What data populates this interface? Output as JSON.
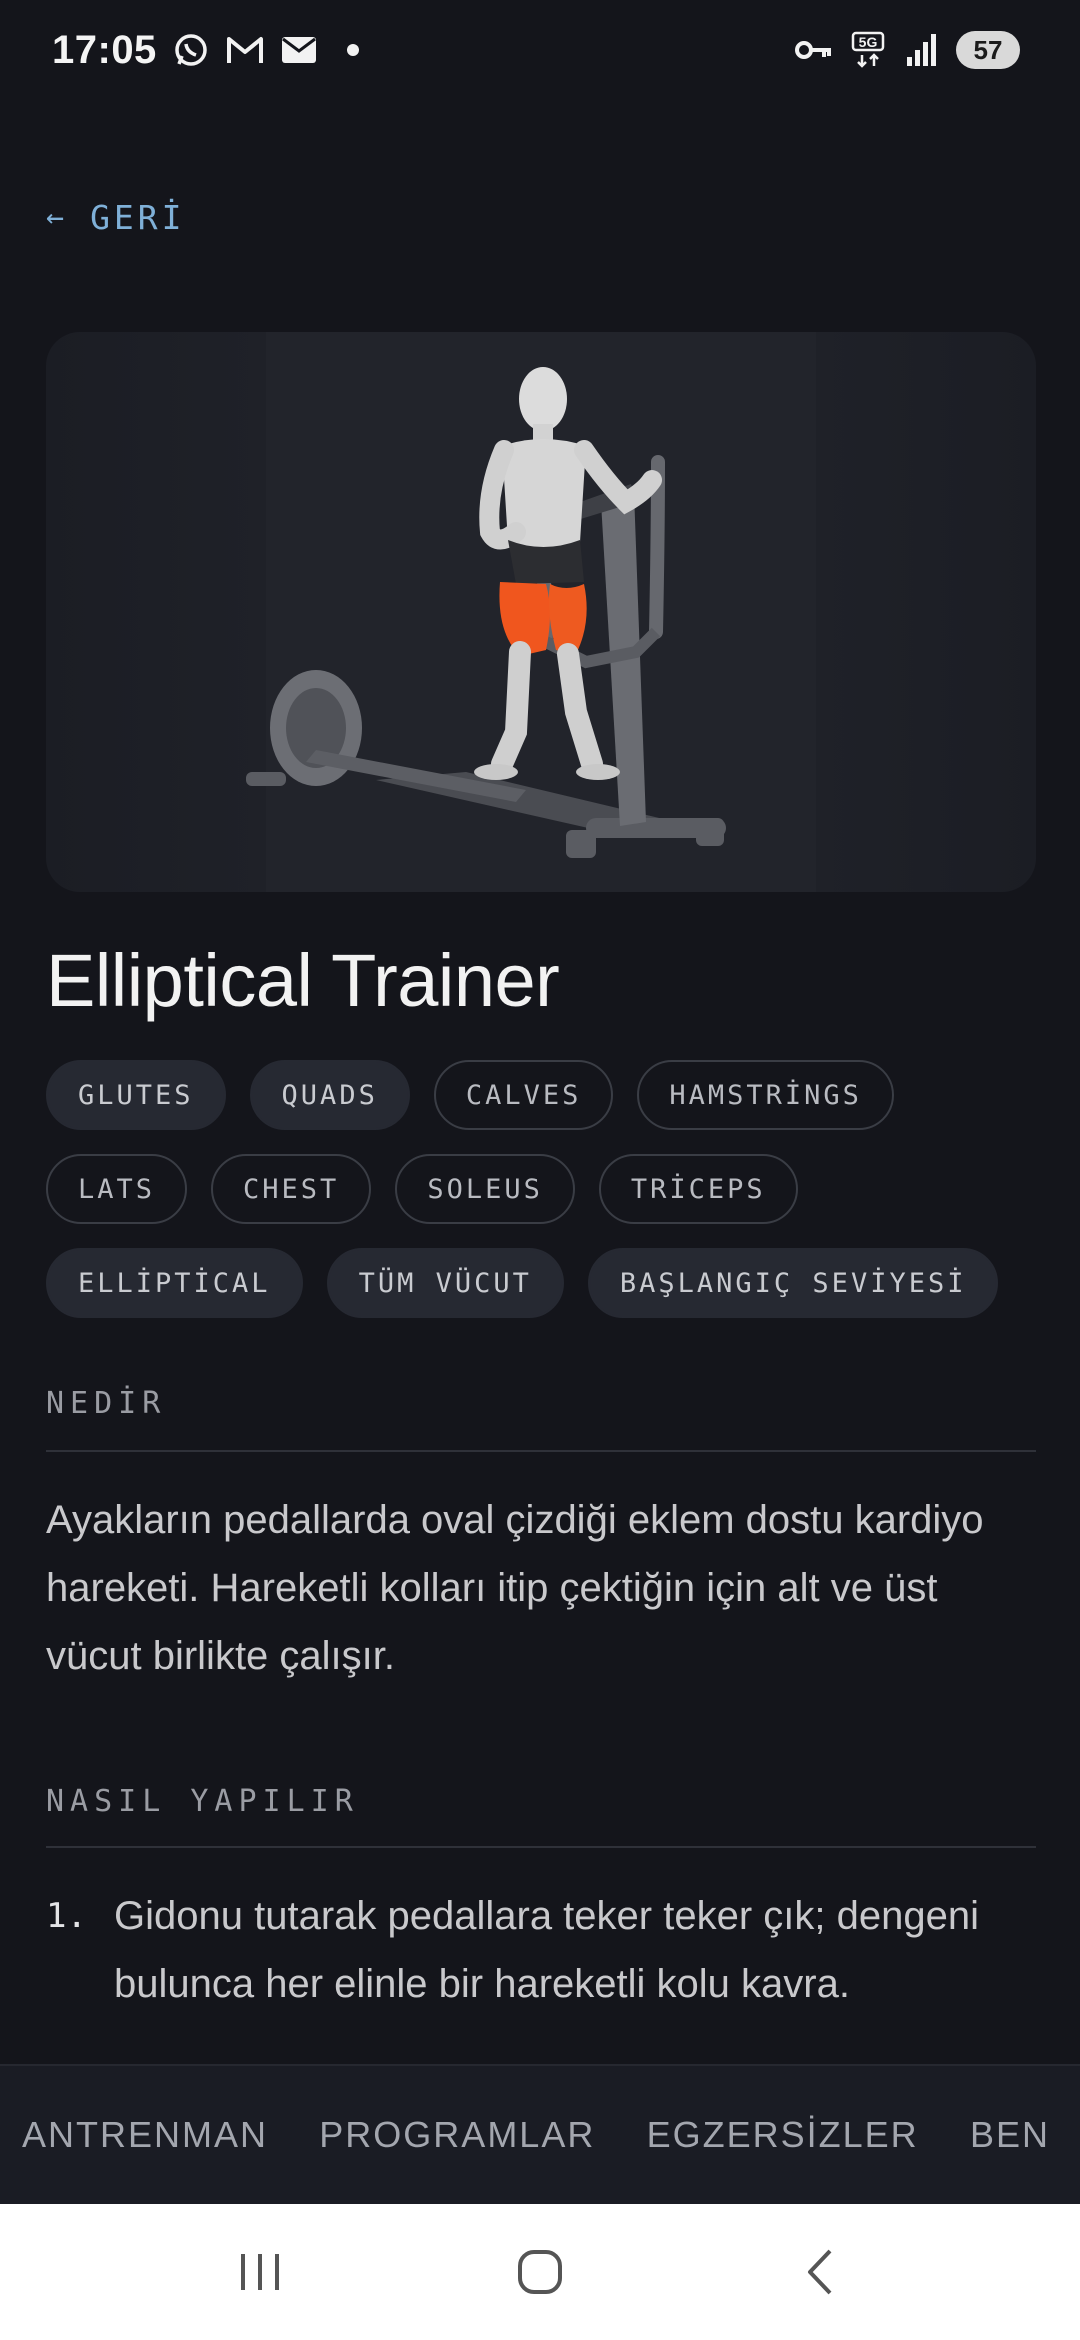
{
  "status_bar": {
    "time": "17:05",
    "network": "5G",
    "battery": "57",
    "icons": [
      "whatsapp-icon",
      "gmail-icon",
      "mail-icon",
      "dot-icon",
      "key-icon",
      "5g-icon",
      "signal-icon",
      "battery-icon"
    ]
  },
  "back": {
    "arrow": "←",
    "label": "GERİ"
  },
  "exercise": {
    "title": "Elliptical Trainer",
    "tags": [
      {
        "label": "GLUTES",
        "style": "filled"
      },
      {
        "label": "QUADS",
        "style": "filled"
      },
      {
        "label": "CALVES",
        "style": "outline"
      },
      {
        "label": "HAMSTRİNGS",
        "style": "outline"
      },
      {
        "label": "LATS",
        "style": "outline"
      },
      {
        "label": "CHEST",
        "style": "outline"
      },
      {
        "label": "SOLEUS",
        "style": "outline"
      },
      {
        "label": "TRİCEPS",
        "style": "outline"
      },
      {
        "label": "ELLİPTİCAL",
        "style": "filled"
      },
      {
        "label": "TÜM VÜCUT",
        "style": "filled"
      },
      {
        "label": "BAŞLANGIÇ SEVİYESİ",
        "style": "filled"
      }
    ]
  },
  "what": {
    "heading": "NEDİR",
    "text": "Ayakların pedallarda oval çizdiği eklem dostu kardiyo hareketi. Hareketli kolları itip çektiğin için alt ve üst vücut birlikte çalışır."
  },
  "how": {
    "heading": "NASIL YAPILIR",
    "steps": [
      {
        "num": "1.",
        "text": "Gidonu tutarak pedallara teker teker çık; dengeni bulunca her elinle bir hareketli kolu kavra."
      }
    ]
  },
  "bottom_nav": {
    "items": [
      "ANTRENMAN",
      "PROGRAMLAR",
      "EGZERSİZLER",
      "BEN"
    ]
  },
  "colors": {
    "background": "#14151b",
    "accent": "#7fb0d8",
    "highlight_muscle": "#f0561e"
  }
}
